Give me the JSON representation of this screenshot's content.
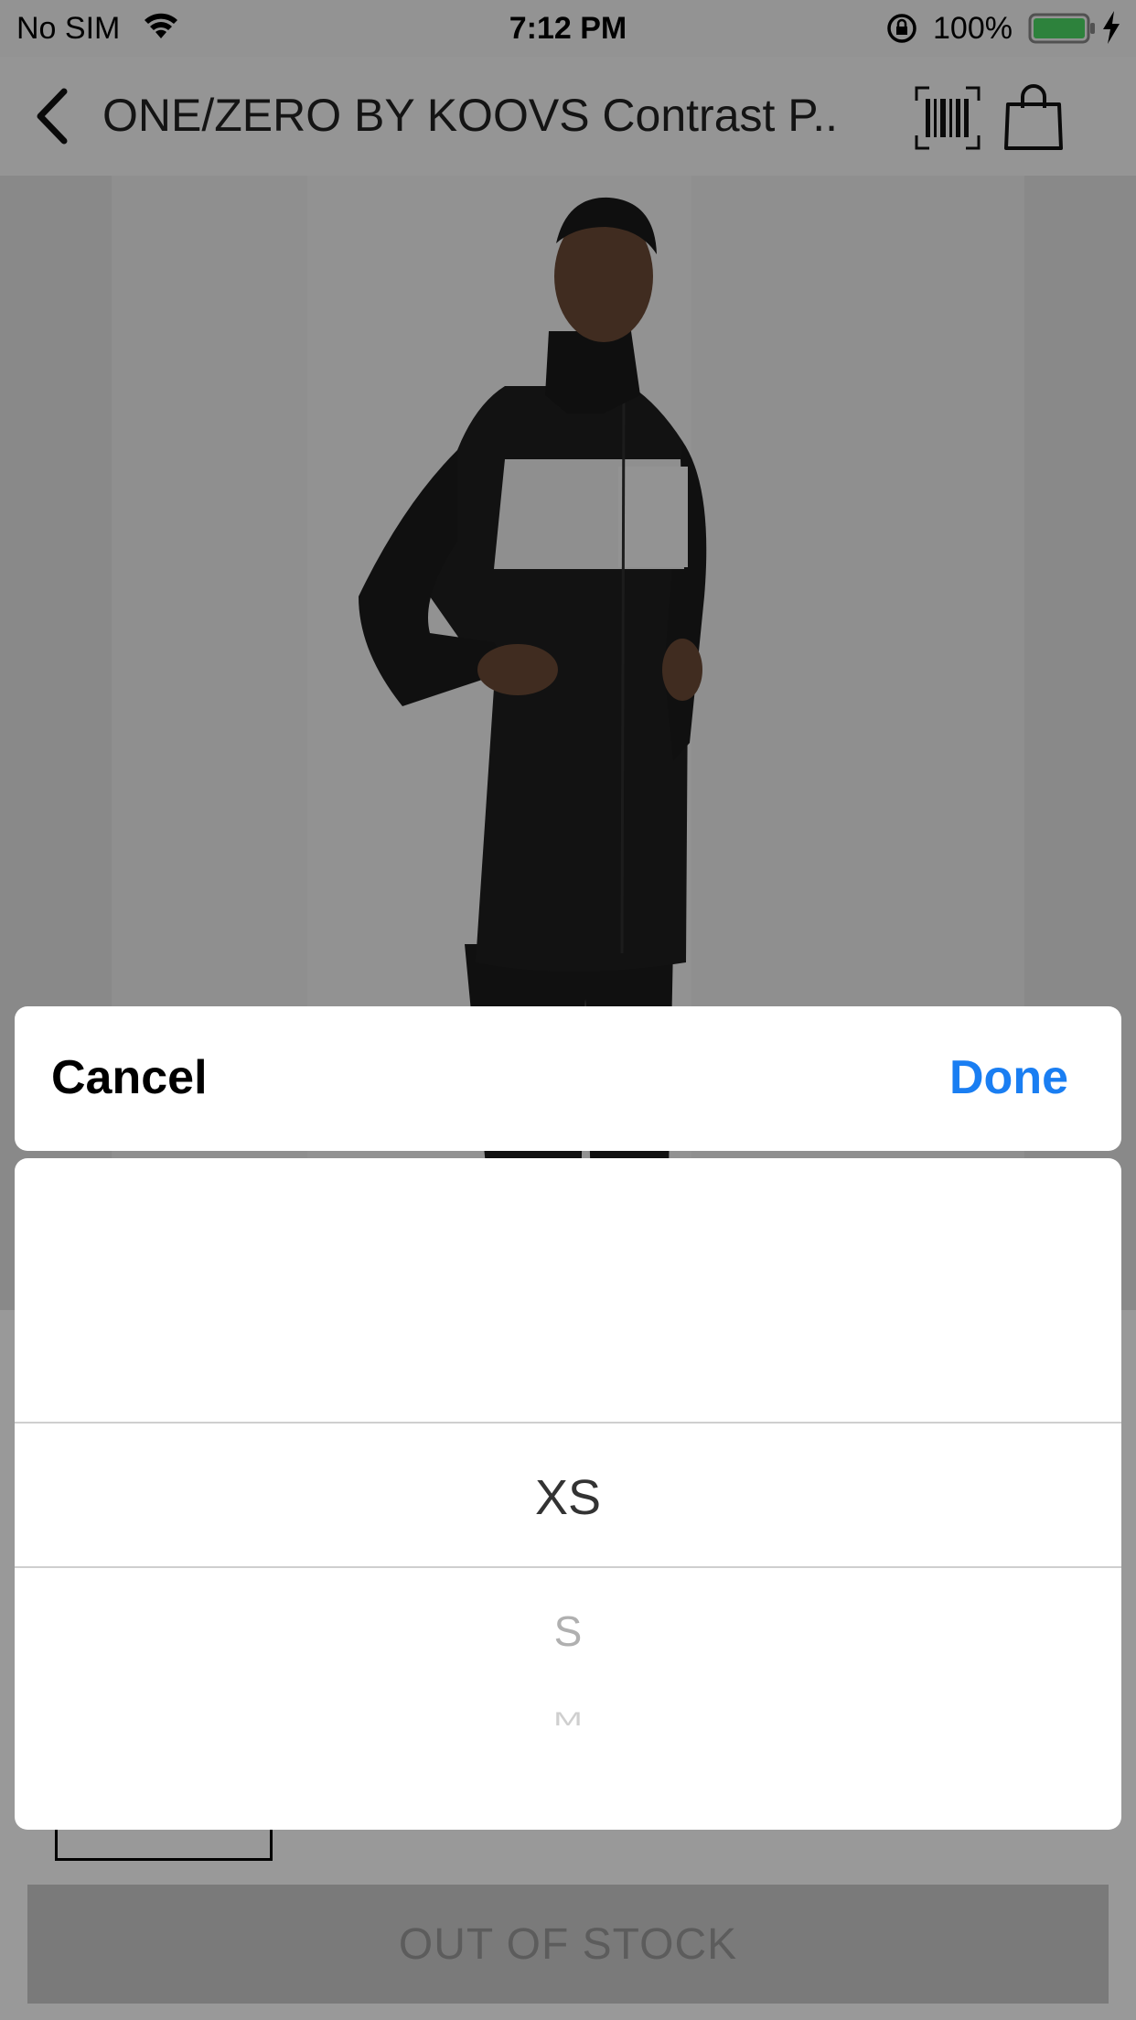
{
  "status_bar": {
    "carrier": "No SIM",
    "time": "7:12 PM",
    "battery_percent": "100%",
    "battery_color": "#4cd964"
  },
  "nav": {
    "title": "ONE/ZERO BY KOOVS Contrast P...",
    "icons": [
      "back-chevron-icon",
      "barcode-icon",
      "shopping-bag-icon"
    ]
  },
  "picker": {
    "cancel_label": "Cancel",
    "done_label": "Done",
    "done_color": "#1a7ef2",
    "options": [
      "XS",
      "S",
      "M"
    ],
    "selected": "XS"
  },
  "footer": {
    "out_of_stock_label": "OUT OF STOCK"
  }
}
